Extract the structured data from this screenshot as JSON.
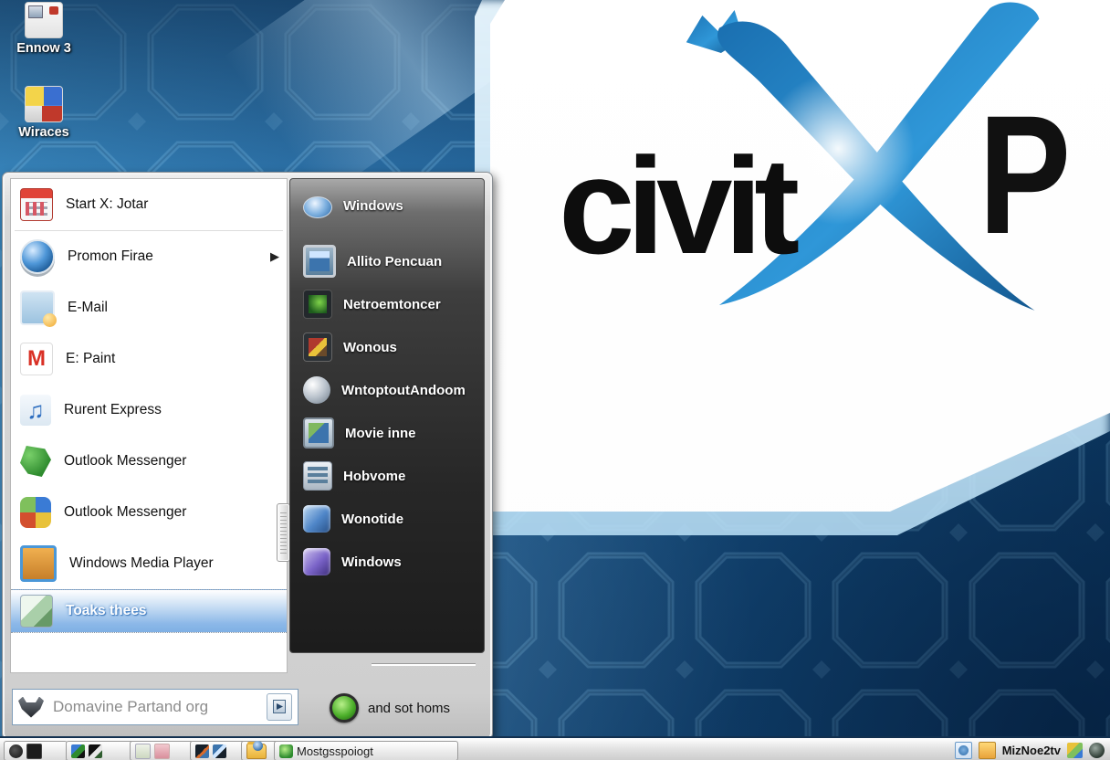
{
  "desktop": {
    "icons": [
      {
        "label": "Ennow 3"
      },
      {
        "label": "Wiraces"
      }
    ],
    "logo": {
      "word": "civit",
      "p": "P"
    }
  },
  "start_menu": {
    "glyphs": {
      "arrow": "▶",
      "music": "♫",
      "mail_m": "M"
    },
    "left_items": [
      {
        "label": "Start X: Jotar",
        "icon": "calendar-icon"
      },
      {
        "label": "Promon Firae",
        "icon": "media-orb-icon",
        "has_submenu": true
      },
      {
        "label": "E-Mail",
        "icon": "picture-icon"
      },
      {
        "label": "E: Paint",
        "icon": "gmail-icon"
      },
      {
        "label": "Rurent Express",
        "icon": "music-notes-icon"
      },
      {
        "label": "Outlook Messenger",
        "icon": "green-puzzle-icon"
      },
      {
        "label": "Outlook Messenger",
        "icon": "color-balls-icon"
      },
      {
        "label": "Windows Media Player",
        "icon": "media-player-tile-icon"
      },
      {
        "label": "Toaks thees",
        "icon": "photo-tile-icon",
        "highlighted": true
      }
    ],
    "right_items": [
      {
        "label": "Windows",
        "icon": "blue-orb-icon"
      },
      {
        "label": "Allito Pencuan",
        "icon": "blue-window-icon"
      },
      {
        "label": "Netroemtoncer",
        "icon": "dark-green-icon"
      },
      {
        "label": "Wonous",
        "icon": "framed-photo-icon"
      },
      {
        "label": "WntoptoutAndoom",
        "icon": "silver-helmet-icon"
      },
      {
        "label": "Movie inne",
        "icon": "monitor-icon"
      },
      {
        "label": "Hobvome",
        "icon": "server-icon"
      },
      {
        "label": "Wonotide",
        "icon": "blue-cube-icon"
      },
      {
        "label": "Windows",
        "icon": "purple-cube-icon"
      }
    ],
    "power": {
      "label": "and sot homs",
      "icon": "green-power-icon"
    },
    "search": {
      "value": "Domavine Partand org"
    }
  },
  "taskbar": {
    "task_button": {
      "label": "Mostgsspoiogt"
    },
    "tray": {
      "text": "MizNoe2tv"
    }
  },
  "colors": {
    "wallpaper_blue": "#1d5c93",
    "x_blue": "#2f97d8",
    "highlight_blue": "#7fb0e4"
  }
}
